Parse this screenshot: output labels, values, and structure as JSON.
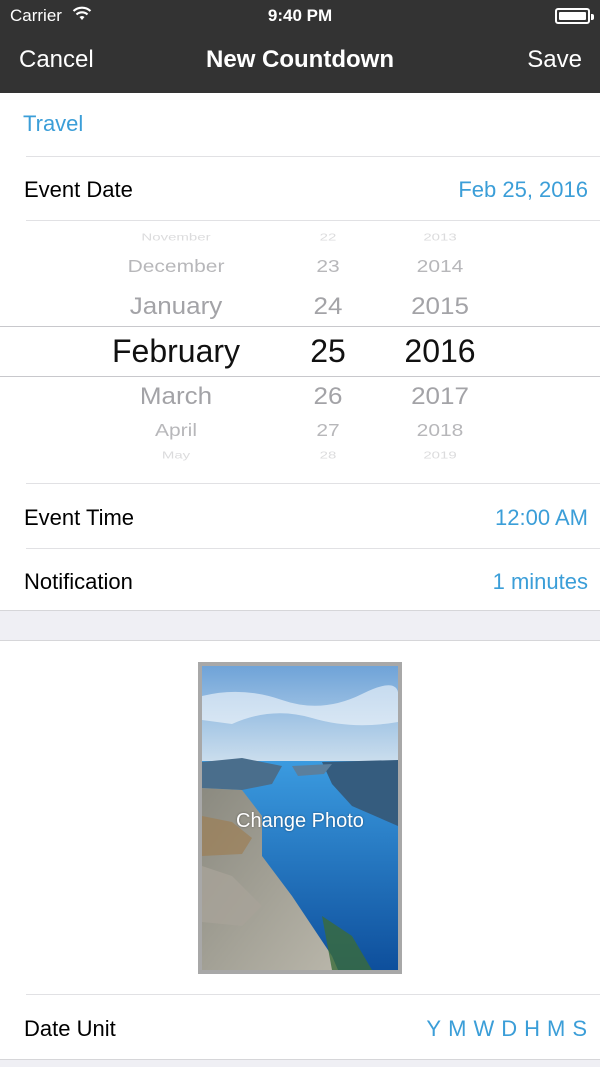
{
  "status_bar": {
    "carrier": "Carrier",
    "time": "9:40 PM"
  },
  "navbar": {
    "title": "New Countdown",
    "cancel_label": "Cancel",
    "save_label": "Save"
  },
  "category": "Travel",
  "event_date": {
    "label": "Event Date",
    "value": "Feb 25, 2016"
  },
  "picker": {
    "months": [
      "November",
      "December",
      "January",
      "February",
      "March",
      "April",
      "May"
    ],
    "days": [
      "22",
      "23",
      "24",
      "25",
      "26",
      "27",
      "28"
    ],
    "years": [
      "2013",
      "2014",
      "2015",
      "2016",
      "2017",
      "2018",
      "2019"
    ],
    "selected_index": 3
  },
  "event_time": {
    "label": "Event Time",
    "value": "12:00 AM"
  },
  "notification": {
    "label": "Notification",
    "value": "1 minutes"
  },
  "photo": {
    "caption": "Change Photo"
  },
  "date_unit": {
    "label": "Date Unit",
    "units": [
      "Y",
      "M",
      "W",
      "D",
      "H",
      "M",
      "S"
    ]
  },
  "colors": {
    "accent": "#3b9ed8",
    "navbar": "#333333",
    "background": "#efeff4"
  }
}
